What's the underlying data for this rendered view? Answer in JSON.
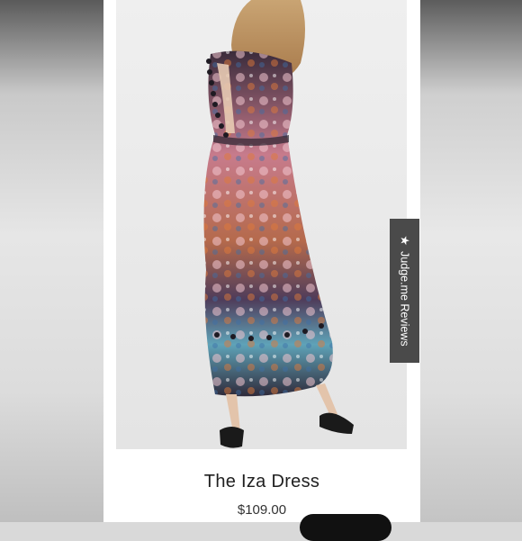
{
  "product": {
    "title": "The Iza Dress",
    "price": "$109.00"
  },
  "reviews_tab": {
    "label": "Judge.me Reviews",
    "icon": "star-icon"
  },
  "colors": {
    "tab_bg": "#4a4a4a",
    "card_bg": "#ffffff",
    "button_bg": "#111111"
  }
}
